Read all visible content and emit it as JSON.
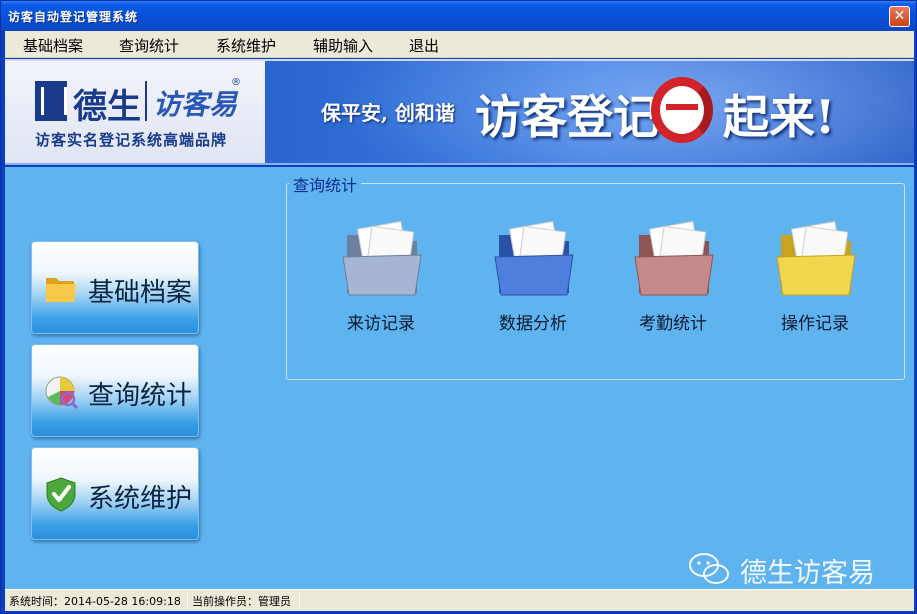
{
  "window": {
    "title": "访客自动登记管理系统"
  },
  "menu": [
    "基础档案",
    "查询统计",
    "系统维护",
    "辅助输入",
    "退出"
  ],
  "banner": {
    "brand_name": "德生",
    "brand_product": "访客易",
    "brand_reg": "®",
    "brand_tagline": "访客实名登记系统高端品牌",
    "slogan_small": "保平安, 创和谐",
    "slogan_big": "访客登记",
    "slogan_tail": "起来!"
  },
  "sidebar": [
    {
      "label": "基础档案",
      "icon": "folder-icon"
    },
    {
      "label": "查询统计",
      "icon": "pie-chart-icon"
    },
    {
      "label": "系统维护",
      "icon": "shield-check-icon"
    }
  ],
  "panel": {
    "title": "查询统计",
    "tiles": [
      {
        "label": "来访记录",
        "icon": "folder-icon",
        "color": "#8fa3c4"
      },
      {
        "label": "数据分析",
        "icon": "folder-icon",
        "color": "#3f6fd0"
      },
      {
        "label": "考勤统计",
        "icon": "folder-icon",
        "color": "#b57878"
      },
      {
        "label": "操作记录",
        "icon": "folder-icon",
        "color": "#e8c93a"
      }
    ]
  },
  "watermark": "德生访客易",
  "status": {
    "time_label": "系统时间：2014-05-28 16:09:18",
    "operator_label": "当前操作员：管理员"
  }
}
